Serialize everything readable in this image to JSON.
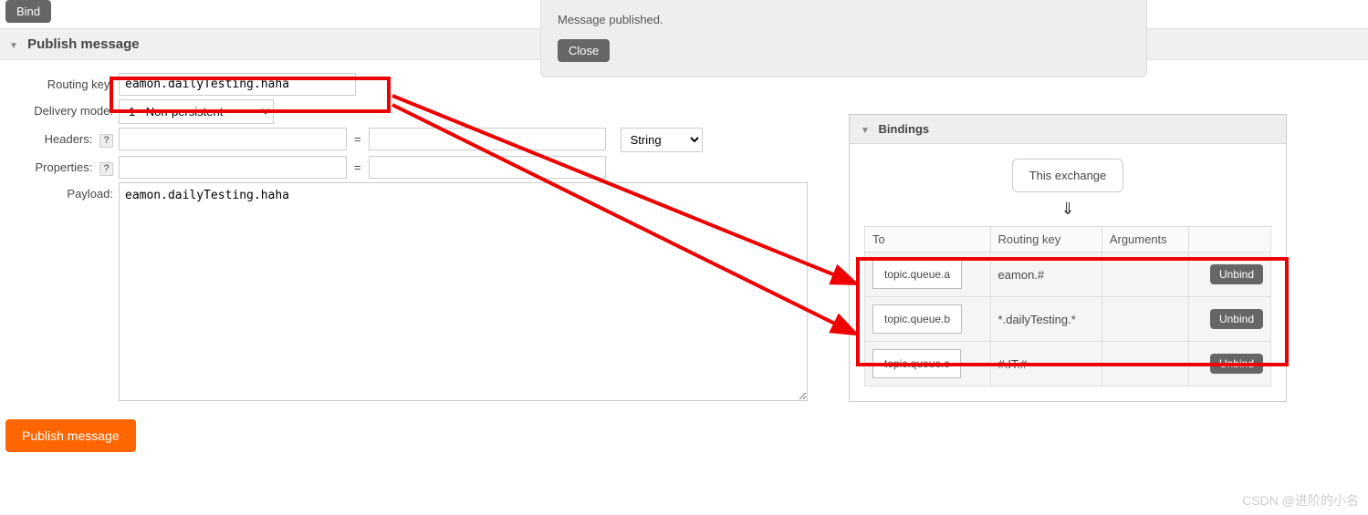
{
  "top_button": "Bind",
  "publish_section_title": "Publish message",
  "form": {
    "routing_key_label": "Routing key:",
    "routing_key_value": "eamon.dailyTesting.haha",
    "delivery_mode_label": "Delivery mode:",
    "delivery_mode_value": "1 - Non-persistent",
    "headers_label": "Headers:",
    "properties_label": "Properties:",
    "payload_label": "Payload:",
    "payload_value": "eamon.dailyTesting.haha",
    "type_option": "String"
  },
  "publish_button": "Publish message",
  "notification": {
    "text": "Message published.",
    "close": "Close"
  },
  "bindings": {
    "title": "Bindings",
    "this_exchange": "This exchange",
    "col_to": "To",
    "col_routing": "Routing key",
    "col_args": "Arguments",
    "rows": [
      {
        "to": "topic.queue.a",
        "routing": "eamon.#",
        "unbind": "Unbind"
      },
      {
        "to": "topic.queue.b",
        "routing": "*.dailyTesting.*",
        "unbind": "Unbind"
      },
      {
        "to": "topic.queue.c",
        "routing": "#.IT.#",
        "unbind": "Unbind"
      }
    ]
  },
  "watermark": "CSDN @进阶的小名"
}
